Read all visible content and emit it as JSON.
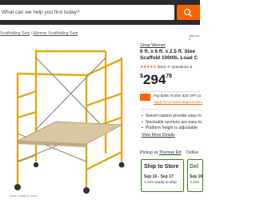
{
  "search": {
    "value": "What can we help you find today?"
  },
  "breadcrumb": {
    "items": [
      "Scaffolding Sets",
      "Werner Scaffolding Sets"
    ],
    "separator": "/"
  },
  "header_right": {
    "text": "Internet #"
  },
  "product": {
    "brand": "Shop Werner",
    "title_line1": "6 ft. x 6 ft. x 2.5 ft. Stee",
    "title_line2": "Scaffold 1000lb. Load C",
    "rating_stars": "★★★★★",
    "review_count": "(504)",
    "qa_label": "Questions &",
    "price_currency": "$",
    "price_dollars": "294",
    "price_cents": "78"
  },
  "financing": {
    "pay_text": "Pay $269.78 after $25 OFF yo",
    "apply_link": "Apply for a Home Depot Consu"
  },
  "highlights": [
    "Swivel casters provide easy m",
    "Stackable sections are easy to",
    "Platform height is adjustable"
  ],
  "view_details": "View More Details",
  "fulfillment": {
    "pickup_label": "Pickup at",
    "store_name": "Thomas Rd",
    "deliver_label": "Delive",
    "ship_title": "Ship to Store",
    "ship_dates": "Sep 16 - Sep 17",
    "ship_count": "3,305",
    "ship_status": "ready to ship",
    "deliver_title": "Del",
    "deliver_dates": "Sep 16",
    "deliver_count": "3,305"
  },
  "image_hint": "Hover Image to Zoom",
  "colors": {
    "brand_orange": "#f96302",
    "header_dark": "#2b2b2b",
    "stock_green": "#3e7c1f",
    "scaffold_yellow": "#f2b51f"
  }
}
